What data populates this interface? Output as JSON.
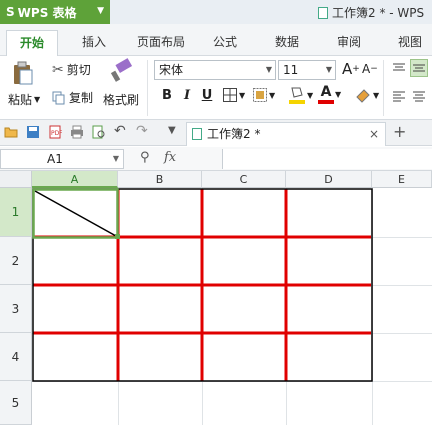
{
  "app": {
    "name": "WPS 表格",
    "logo": "S",
    "title": "工作簿2 * - WPS"
  },
  "tabs": [
    "开始",
    "插入",
    "页面布局",
    "公式",
    "数据",
    "审阅",
    "视图"
  ],
  "active_tab": "开始",
  "ribbon": {
    "paste_label": "粘贴",
    "cut_label": "剪切",
    "copy_label": "复制",
    "format_painter_label": "格式刷",
    "font_name": "宋体",
    "font_size": "11",
    "bold": "B",
    "italic": "I",
    "underline": "U",
    "grow_font": "A",
    "shrink_font": "A",
    "font_color_letter": "A"
  },
  "doc_tab": {
    "label": "工作簿2 *",
    "close": "×"
  },
  "new_tab": "+",
  "formula_bar": {
    "name_box": "A1",
    "fx": "fx",
    "value": ""
  },
  "columns": [
    "A",
    "B",
    "C",
    "D",
    "E"
  ],
  "rows": [
    "1",
    "2",
    "3",
    "4",
    "5"
  ],
  "selected_cell": "A1",
  "colors": {
    "accent_green": "#5ea239",
    "border_red": "#e00000",
    "selection_green": "#6aa84f",
    "outer_border": "#000000"
  },
  "icons": [
    "paste-icon",
    "cut-icon",
    "copy-icon",
    "format-painter-icon",
    "open-icon",
    "save-icon",
    "pdf-icon",
    "print-icon",
    "print-preview-icon",
    "undo-icon",
    "redo-icon",
    "zoom-icon"
  ]
}
